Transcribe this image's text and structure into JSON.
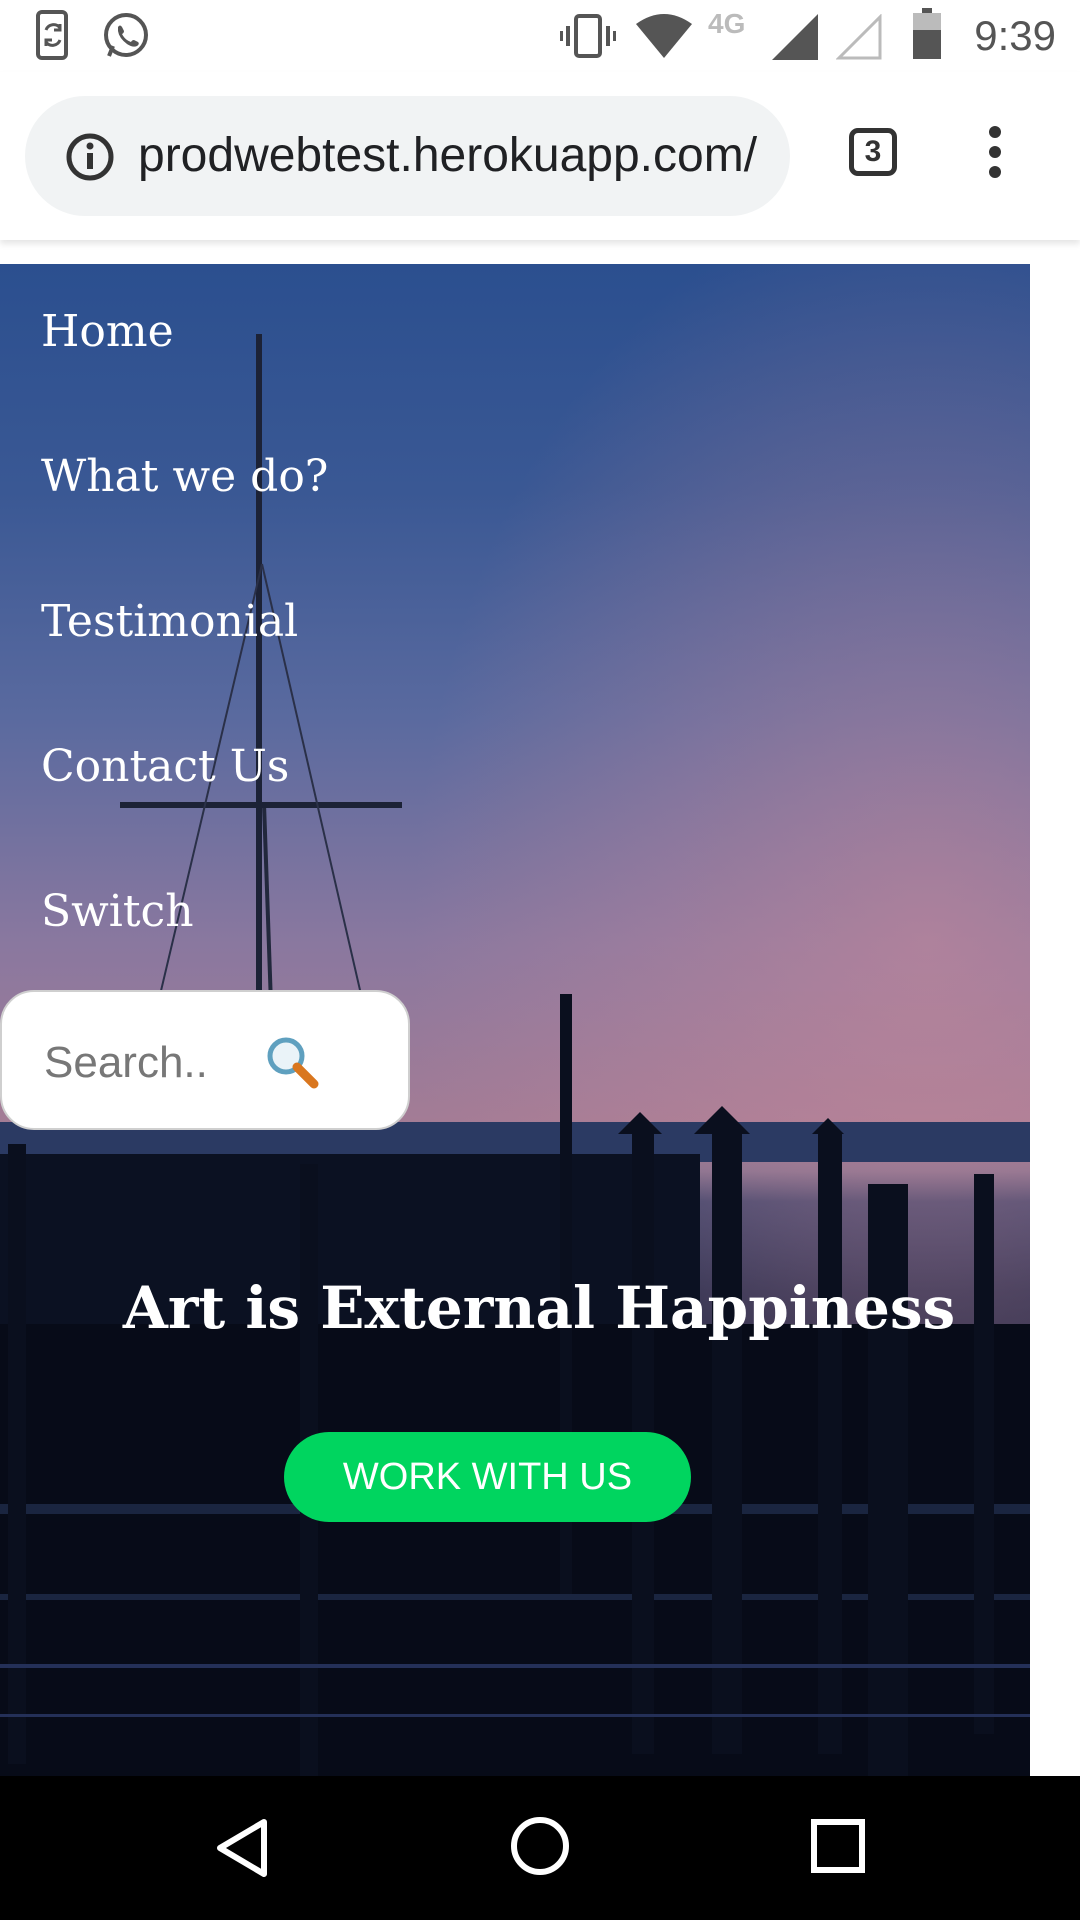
{
  "status_bar": {
    "time": "9:39",
    "network_type": "4G",
    "left_icons": [
      "phone-sync-icon",
      "whatsapp-icon"
    ],
    "right_icons": [
      "vibrate-icon",
      "wifi-icon",
      "signal-icon",
      "signal-empty-icon",
      "battery-icon"
    ]
  },
  "browser": {
    "url": "prodwebtest.herokuapp.com/",
    "tab_count": "3"
  },
  "nav": {
    "items": [
      {
        "label": "Home"
      },
      {
        "label": "What we do?"
      },
      {
        "label": "Testimonial"
      },
      {
        "label": "Contact Us"
      },
      {
        "label": "Switch"
      }
    ]
  },
  "search": {
    "placeholder": "Search.."
  },
  "hero": {
    "tagline": "Art is External Happiness",
    "cta_label": "WORK WITH US"
  },
  "colors": {
    "cta_green": "#00d55f",
    "sky_top": "#2b4f8f",
    "sky_glow": "#a47c95"
  }
}
